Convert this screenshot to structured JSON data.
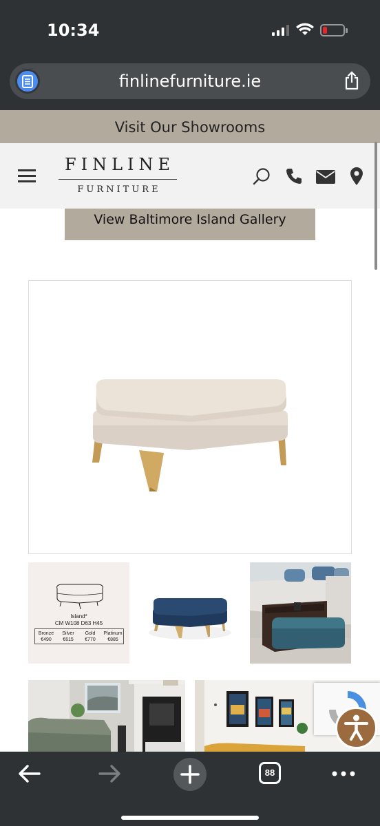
{
  "status": {
    "time": "10:34"
  },
  "browser": {
    "url": "finlinefurniture.ie",
    "tab_count": "88"
  },
  "site": {
    "banner": "Visit Our Showrooms",
    "logo_top": "FINLINE",
    "logo_bottom": "FURNITURE",
    "gallery_button": "View Baltimore Island Gallery"
  },
  "spec_card": {
    "model": "Island*",
    "dimensions": "CM  W108  D63  H45",
    "prices": [
      {
        "tier": "Bronze",
        "price": "€490"
      },
      {
        "tier": "Silver",
        "price": "€615"
      },
      {
        "tier": "Gold",
        "price": "€770"
      },
      {
        "tier": "Platinum",
        "price": "€885"
      }
    ]
  },
  "colors": {
    "browser_chrome": "#2f3234",
    "brand_taupe": "#b3aa9e",
    "accessibility_button": "#9b6a3e"
  },
  "icons": [
    "reader-icon",
    "share-icon",
    "menu-icon",
    "search-icon",
    "phone-icon",
    "mail-icon",
    "location-icon",
    "accessibility-icon",
    "back-icon",
    "forward-icon",
    "new-tab-icon",
    "tabs-icon",
    "more-icon"
  ]
}
